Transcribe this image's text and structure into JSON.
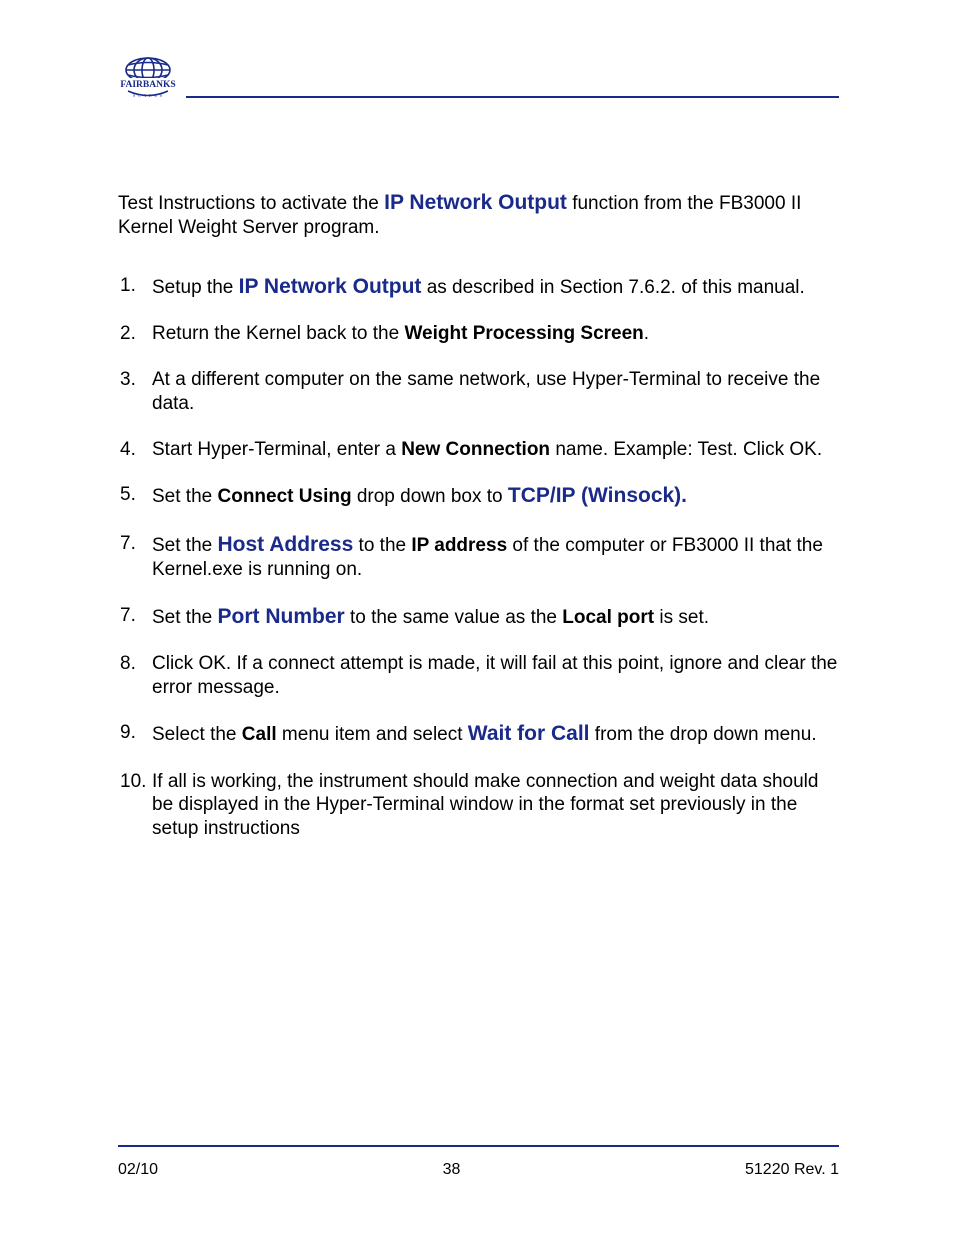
{
  "brand": "FAIRBANKS",
  "intro": {
    "pre": "Test Instructions to activate the ",
    "bold_blue": "IP Network Output",
    "post": " function from the FB3000 II Kernel Weight Server program."
  },
  "steps": [
    {
      "n": "1.",
      "parts": [
        {
          "t": "Setup the "
        },
        {
          "t": "IP Network Output",
          "cls": "bb"
        },
        {
          "t": " as described in Section 7.6.2. of this manual."
        }
      ]
    },
    {
      "n": "2.",
      "parts": [
        {
          "t": "Return the Kernel back to the "
        },
        {
          "t": "Weight Processing Screen",
          "cls": "b"
        },
        {
          "t": "."
        }
      ]
    },
    {
      "n": "3.",
      "parts": [
        {
          "t": "At a different computer on the same network, use Hyper-Terminal to receive the data."
        }
      ]
    },
    {
      "n": "4.",
      "parts": [
        {
          "t": "Start Hyper-Terminal, enter a "
        },
        {
          "t": "New Connection",
          "cls": "b"
        },
        {
          "t": " name.  Example: Test.  Click OK."
        }
      ]
    },
    {
      "n": "5.",
      "parts": [
        {
          "t": "Set the "
        },
        {
          "t": "Connect Using",
          "cls": "b"
        },
        {
          "t": " drop down box to "
        },
        {
          "t": "TCP/IP (Winsock).",
          "cls": "bb"
        }
      ]
    },
    {
      "n": "7.",
      "parts": [
        {
          "t": "Set the "
        },
        {
          "t": "Host Address",
          "cls": "bb"
        },
        {
          "t": " to the "
        },
        {
          "t": "IP address",
          "cls": "b"
        },
        {
          "t": " of the computer or FB3000 II that the Kernel.exe is running on."
        }
      ]
    },
    {
      "n": "7.",
      "parts": [
        {
          "t": "Set the "
        },
        {
          "t": "Port Number",
          "cls": "bb"
        },
        {
          "t": " to the same value as the "
        },
        {
          "t": "Local port",
          "cls": "b"
        },
        {
          "t": " is set."
        }
      ]
    },
    {
      "n": "8.",
      "parts": [
        {
          "t": "Click OK. If a connect attempt is made, it will fail at this point, ignore and clear the error message."
        }
      ]
    },
    {
      "n": "9.",
      "parts": [
        {
          "t": "Select the "
        },
        {
          "t": "Call",
          "cls": "b"
        },
        {
          "t": " menu item and select "
        },
        {
          "t": "Wait for Call",
          "cls": "bb"
        },
        {
          "t": " from the drop down menu."
        }
      ]
    },
    {
      "n": "10.",
      "parts": [
        {
          "t": "If all is working, the instrument should make connection and weight data should be displayed in the Hyper-Terminal window in the format set previously in the setup instructions"
        }
      ]
    }
  ],
  "footer": {
    "left": "02/10",
    "center": "38",
    "right": "51220   Rev. 1"
  }
}
